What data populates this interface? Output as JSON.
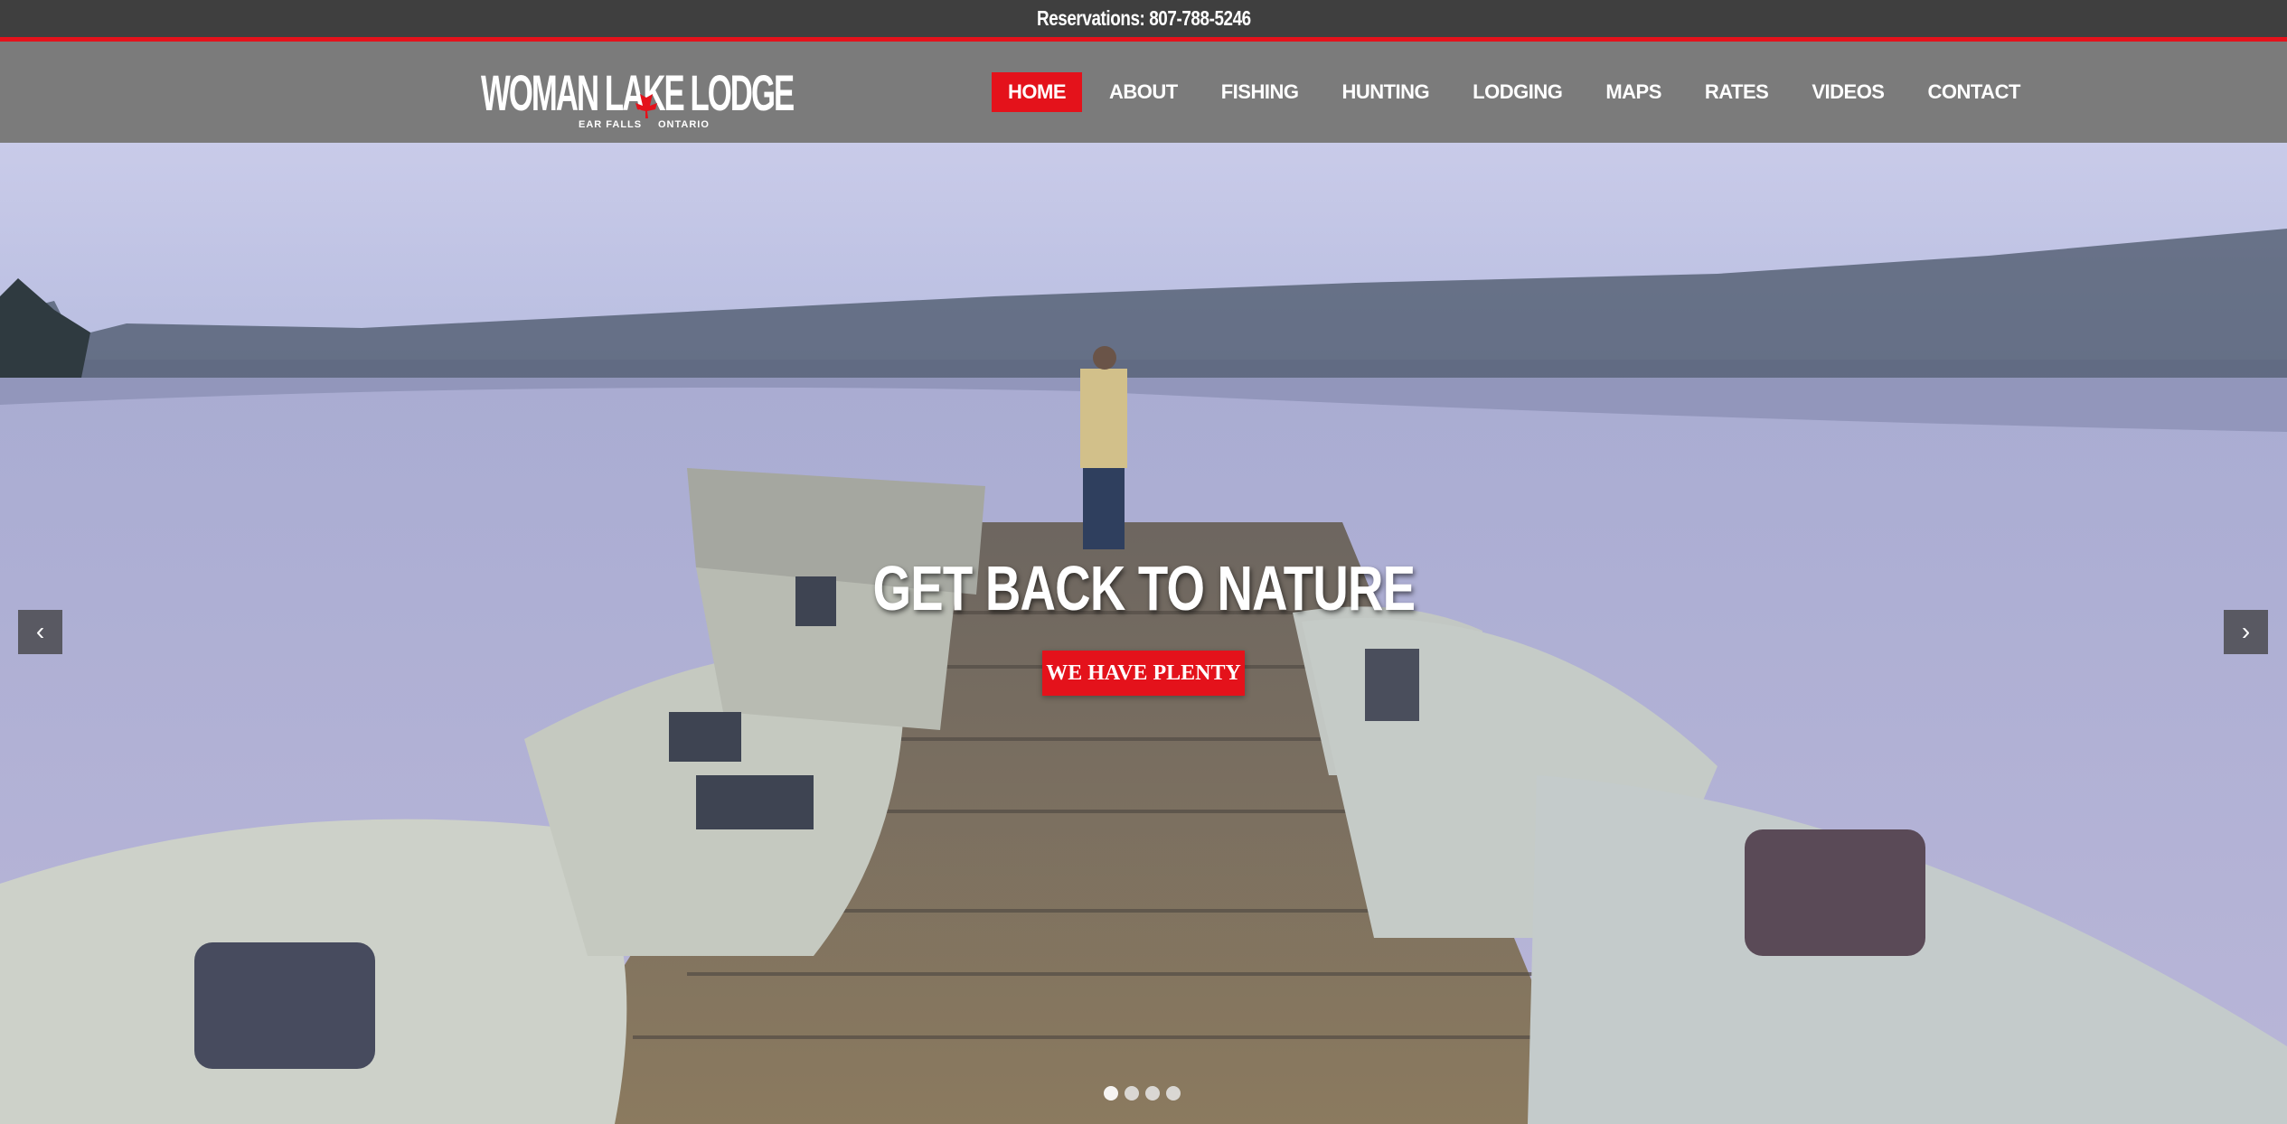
{
  "topbar": {
    "reservations": "Reservations: 807-788-5246"
  },
  "logo": {
    "name": "WOMAN LAKE LODGE",
    "place_left": "EAR FALLS",
    "place_right": "ONTARIO",
    "emblem": "maple-leaf-icon"
  },
  "nav": {
    "items": [
      {
        "label": "HOME",
        "active": true
      },
      {
        "label": "ABOUT"
      },
      {
        "label": "FISHING"
      },
      {
        "label": "HUNTING"
      },
      {
        "label": "LODGING"
      },
      {
        "label": "MAPS"
      },
      {
        "label": "RATES"
      },
      {
        "label": "VIDEOS"
      },
      {
        "label": "CONTACT"
      }
    ]
  },
  "hero": {
    "headline": "GET BACK TO NATURE",
    "cta": "WE HAVE PLENTY",
    "prev_icon": "chevron-left-icon",
    "next_icon": "chevron-right-icon",
    "slide_count": 4,
    "active_slide": 1
  },
  "colors": {
    "accent": "#e4121b",
    "topbar": "#3f3f3f",
    "navbar": "#7b7b7b"
  }
}
